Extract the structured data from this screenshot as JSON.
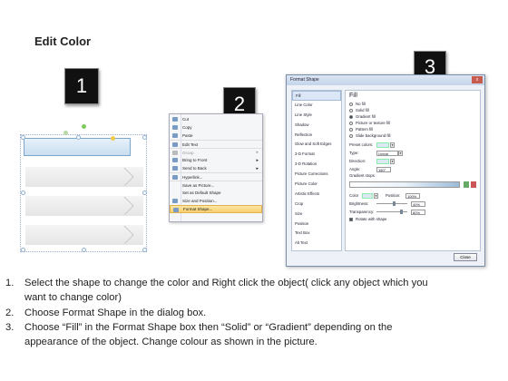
{
  "heading": "Edit Color",
  "badges": [
    "1",
    "2",
    "3"
  ],
  "context_menu": {
    "items": [
      {
        "label": "Cut",
        "icon": "scissors-icon",
        "disabled": false
      },
      {
        "label": "Copy",
        "icon": "copy-icon",
        "disabled": false
      },
      {
        "label": "Paste",
        "icon": "paste-icon",
        "disabled": false
      },
      {
        "label": "Edit Text",
        "icon": "edit-text-icon",
        "disabled": false
      },
      {
        "label": "Group",
        "icon": "group-icon",
        "disabled": true,
        "submenu": true
      },
      {
        "label": "Bring to Front",
        "icon": "bring-front-icon",
        "disabled": false,
        "submenu": true
      },
      {
        "label": "Send to Back",
        "icon": "send-back-icon",
        "disabled": false,
        "submenu": true
      },
      {
        "label": "Hyperlink...",
        "icon": "hyperlink-icon",
        "disabled": false
      },
      {
        "label": "Save as Picture...",
        "icon": "",
        "disabled": false
      },
      {
        "label": "Set as Default Shape",
        "icon": "",
        "disabled": false
      },
      {
        "label": "Size and Position...",
        "icon": "size-icon",
        "disabled": false
      },
      {
        "label": "Format Shape...",
        "icon": "format-shape-icon",
        "disabled": false,
        "highlighted": true
      }
    ]
  },
  "dialog": {
    "title": "Format Shape",
    "close_label": "x",
    "nav_items": [
      "Fill",
      "Line Color",
      "Line Style",
      "Shadow",
      "Reflection",
      "Glow and Soft Edges",
      "3-D Format",
      "3-D Rotation",
      "Picture Corrections",
      "Picture Color",
      "Artistic Effects",
      "Crop",
      "Size",
      "Position",
      "Text Box",
      "Alt Text"
    ],
    "active_nav": "Fill",
    "section_title": "Fill",
    "fill_options": [
      "No fill",
      "Solid fill",
      "Gradient fill",
      "Picture or texture fill",
      "Pattern fill",
      "Slide background fill"
    ],
    "selected_fill": "Gradient fill",
    "preset_colors_label": "Preset colors:",
    "type_label": "Type:",
    "type_value": "Linear",
    "direction_label": "Direction:",
    "angle_label": "Angle:",
    "angle_value": "180°",
    "gradient_stops_label": "Gradient stops",
    "color_label": "Color",
    "position_label": "Position:",
    "position_value": "100%",
    "brightness_label": "Brightness:",
    "brightness_value": "40%",
    "transparency_label": "Transparency:",
    "transparency_value": "80%",
    "rotate_label": "Rotate with shape",
    "close_button": "Close"
  },
  "steps": [
    {
      "num": "1.",
      "lines": [
        "Select the shape to change the color and Right click the object( click any object which you",
        "want to change color)"
      ]
    },
    {
      "num": "2.",
      "lines": [
        "Choose Format Shape in the dialog box."
      ]
    },
    {
      "num": "3.",
      "lines": [
        "Choose “Fill” in the Format Shape box then “Solid” or “Gradient” depending on the",
        "appearance of the object. Change colour as shown in the picture."
      ]
    }
  ]
}
